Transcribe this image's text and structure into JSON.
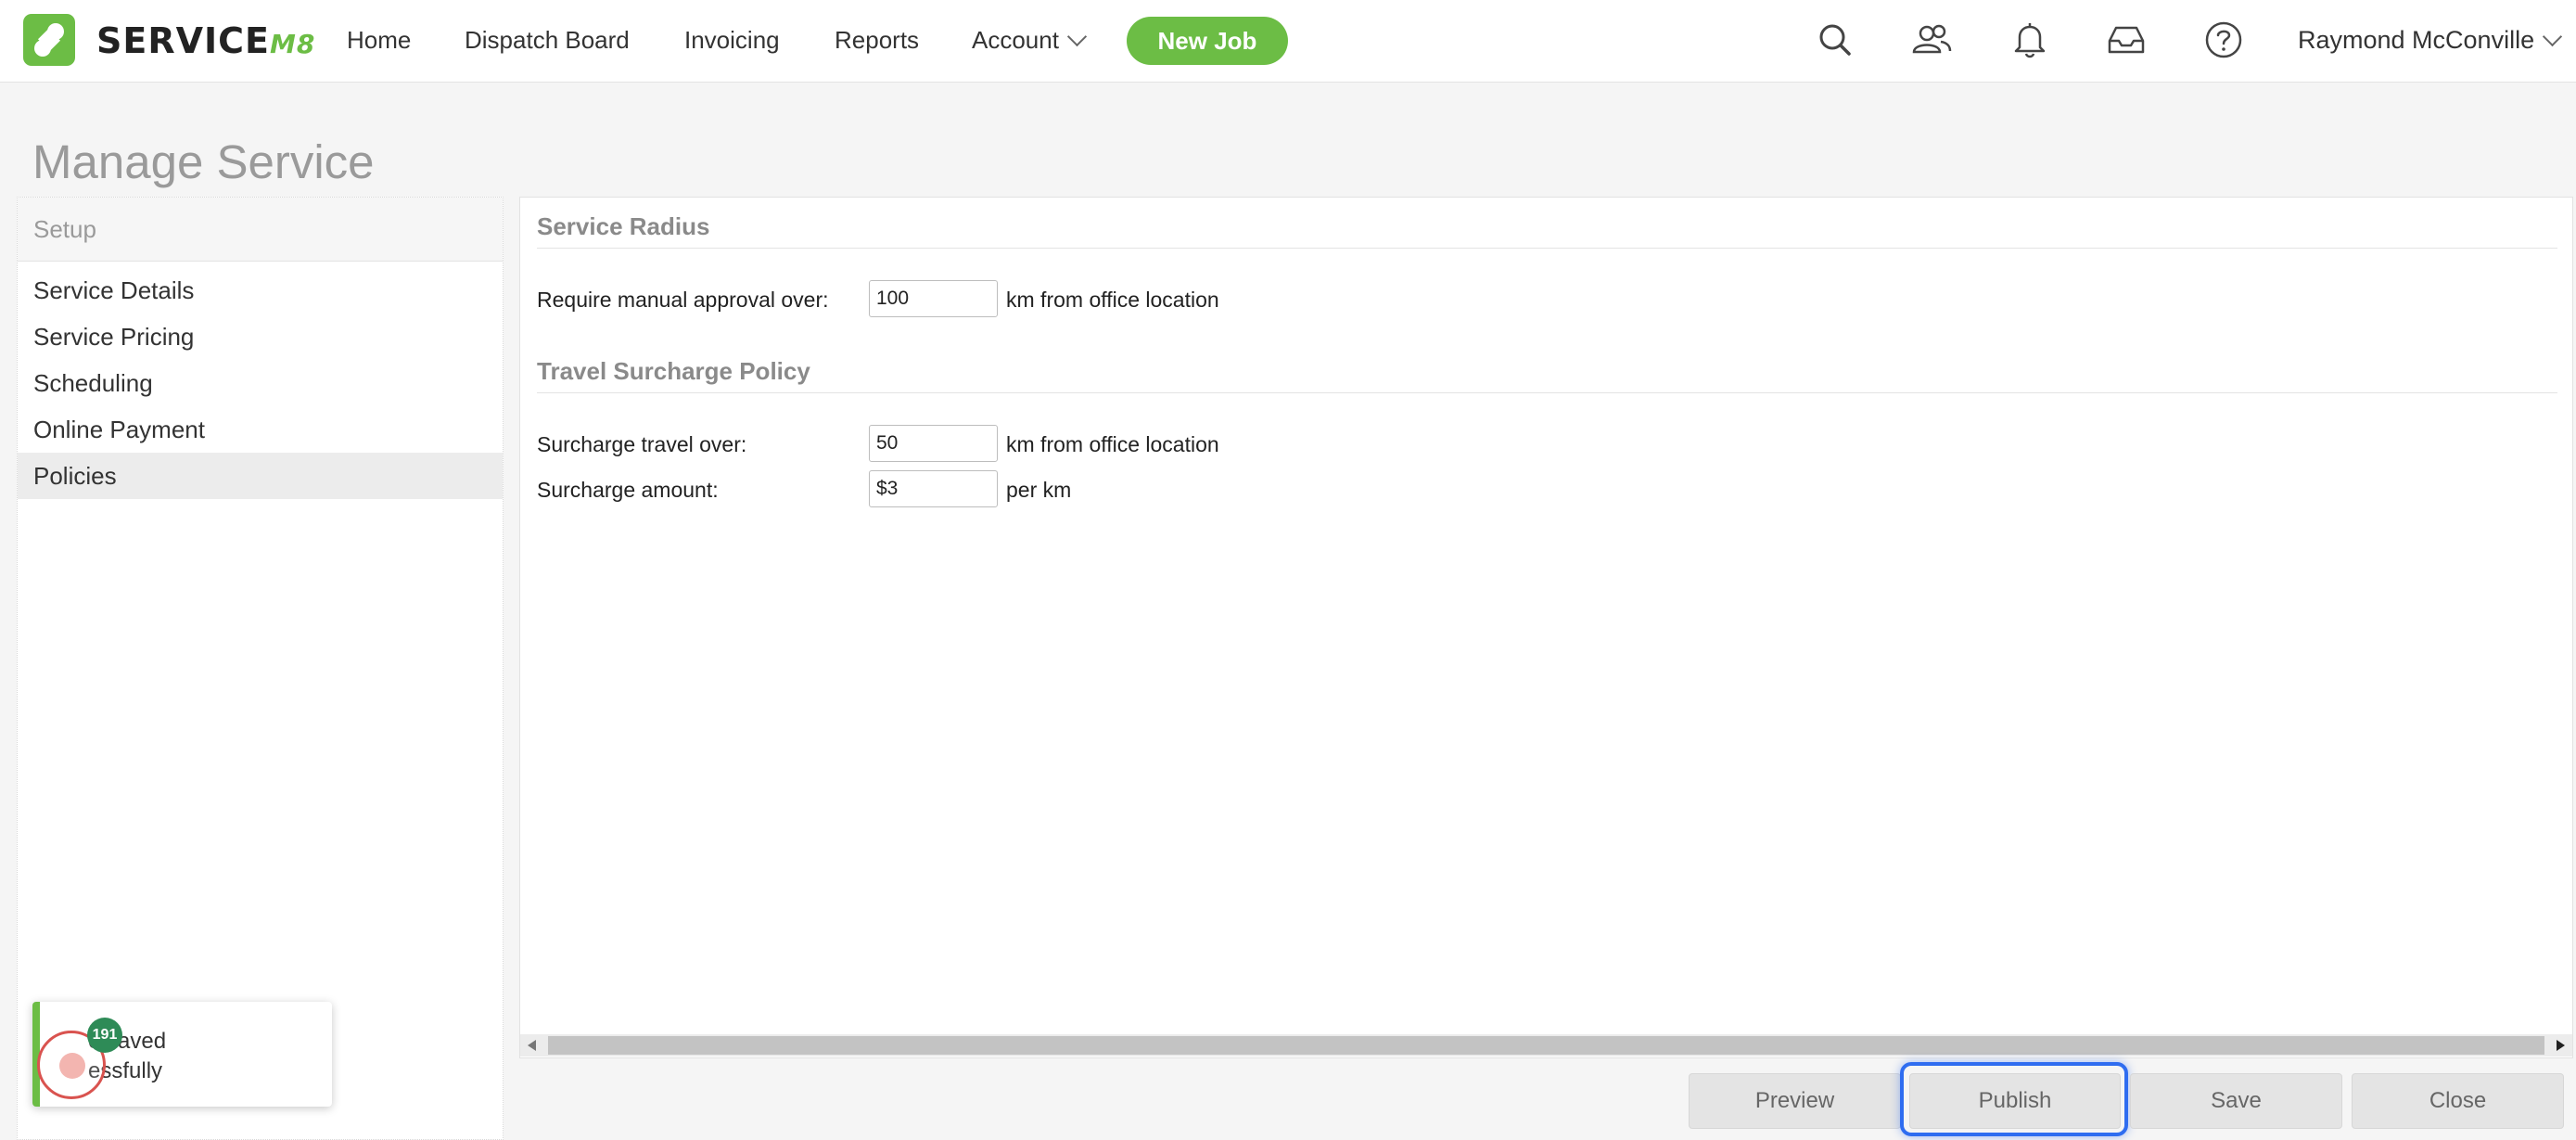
{
  "app": {
    "logo_text": "SERVICE",
    "logo_suffix": "M8",
    "accent_color": "#6cbd45"
  },
  "nav": {
    "home": "Home",
    "dispatch": "Dispatch Board",
    "invoicing": "Invoicing",
    "reports": "Reports",
    "account": "Account",
    "new_job": "New Job",
    "user": "Raymond McConville",
    "icons": [
      "search-icon",
      "people-icon",
      "bell-icon",
      "inbox-icon",
      "help-icon"
    ]
  },
  "page": {
    "title": "Manage Service"
  },
  "sidebar": {
    "header": "Setup",
    "items": [
      {
        "label": "Service Details"
      },
      {
        "label": "Service Pricing"
      },
      {
        "label": "Scheduling"
      },
      {
        "label": "Online Payment"
      },
      {
        "label": "Policies",
        "active": true
      }
    ]
  },
  "radius": {
    "title": "Service Radius",
    "label": "Require manual approval over:",
    "value": "100",
    "suffix": "km from office location"
  },
  "surcharge": {
    "title": "Travel Surcharge Policy",
    "over_label": "Surcharge travel over:",
    "over_value": "50",
    "over_suffix": "km from office location",
    "amount_label": "Surcharge amount:",
    "amount_value": "$3",
    "amount_suffix": "per km"
  },
  "footer": {
    "preview": "Preview",
    "publish": "Publish",
    "save": "Save",
    "close": "Close"
  },
  "toast": {
    "line1": "e saved",
    "line2": "essfully"
  },
  "cursor": {
    "badge": "191"
  }
}
